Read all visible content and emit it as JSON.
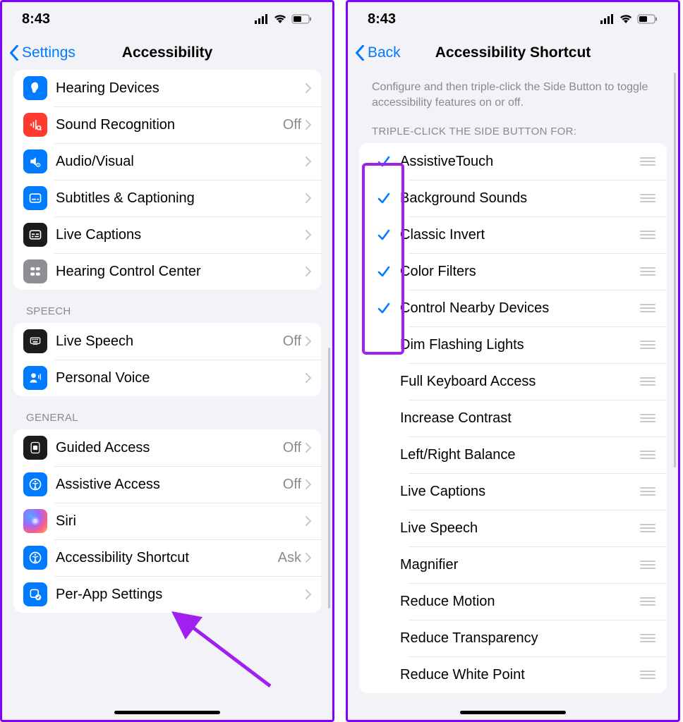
{
  "status": {
    "time": "8:43"
  },
  "left": {
    "back_label": "Settings",
    "title": "Accessibility",
    "hearing_group": [
      {
        "icon": "ear-icon",
        "color": "blue",
        "label": "Hearing Devices",
        "value": ""
      },
      {
        "icon": "sound-recog-icon",
        "color": "red",
        "label": "Sound Recognition",
        "value": "Off"
      },
      {
        "icon": "audio-visual-icon",
        "color": "blue",
        "label": "Audio/Visual",
        "value": ""
      },
      {
        "icon": "subtitles-icon",
        "color": "blue",
        "label": "Subtitles & Captioning",
        "value": ""
      },
      {
        "icon": "live-captions-icon",
        "color": "dark",
        "label": "Live Captions",
        "value": ""
      },
      {
        "icon": "hearing-control-icon",
        "color": "gray",
        "label": "Hearing Control Center",
        "value": ""
      }
    ],
    "speech_header": "SPEECH",
    "speech_group": [
      {
        "icon": "live-speech-icon",
        "color": "dark",
        "label": "Live Speech",
        "value": "Off"
      },
      {
        "icon": "personal-voice-icon",
        "color": "blue",
        "label": "Personal Voice",
        "value": ""
      }
    ],
    "general_header": "GENERAL",
    "general_group": [
      {
        "icon": "guided-access-icon",
        "color": "dark",
        "label": "Guided Access",
        "value": "Off"
      },
      {
        "icon": "assistive-access-icon",
        "color": "blue",
        "label": "Assistive Access",
        "value": "Off"
      },
      {
        "icon": "siri-icon",
        "color": "siri",
        "label": "Siri",
        "value": ""
      },
      {
        "icon": "accessibility-shortcut-icon",
        "color": "blue",
        "label": "Accessibility Shortcut",
        "value": "Ask"
      },
      {
        "icon": "per-app-icon",
        "color": "blue",
        "label": "Per-App Settings",
        "value": ""
      }
    ]
  },
  "right": {
    "back_label": "Back",
    "title": "Accessibility Shortcut",
    "description": "Configure and then triple-click the Side Button to toggle accessibility features on or off.",
    "list_header": "TRIPLE-CLICK THE SIDE BUTTON FOR:",
    "items": [
      {
        "label": "AssistiveTouch",
        "checked": true
      },
      {
        "label": "Background Sounds",
        "checked": true
      },
      {
        "label": "Classic Invert",
        "checked": true
      },
      {
        "label": "Color Filters",
        "checked": true
      },
      {
        "label": "Control Nearby Devices",
        "checked": true
      },
      {
        "label": "Dim Flashing Lights",
        "checked": false
      },
      {
        "label": "Full Keyboard Access",
        "checked": false
      },
      {
        "label": "Increase Contrast",
        "checked": false
      },
      {
        "label": "Left/Right Balance",
        "checked": false
      },
      {
        "label": "Live Captions",
        "checked": false
      },
      {
        "label": "Live Speech",
        "checked": false
      },
      {
        "label": "Magnifier",
        "checked": false
      },
      {
        "label": "Reduce Motion",
        "checked": false
      },
      {
        "label": "Reduce Transparency",
        "checked": false
      },
      {
        "label": "Reduce White Point",
        "checked": false
      }
    ]
  },
  "annotations": {
    "highlight_purpose": "checkmark-column-highlight",
    "arrow_purpose": "points-to-accessibility-shortcut-row"
  }
}
